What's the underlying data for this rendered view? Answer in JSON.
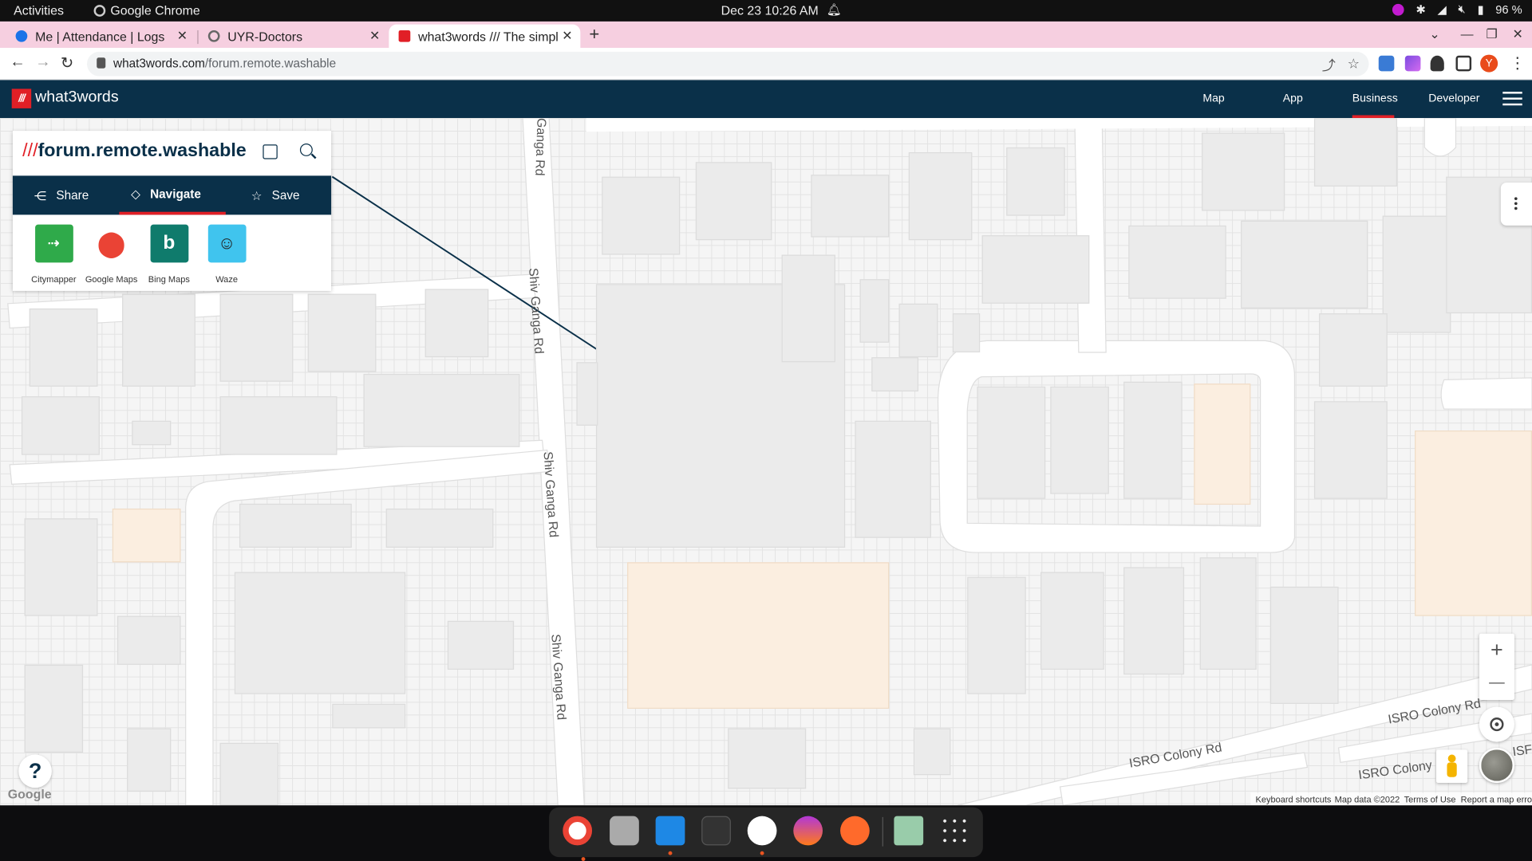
{
  "system_bar": {
    "activities": "Activities",
    "app_name": "Google Chrome",
    "clock": "Dec 23  10:26 AM",
    "battery": "96 %"
  },
  "browser": {
    "tabs": [
      {
        "title": "Me | Attendance | Logs",
        "active": false
      },
      {
        "title": "UYR-Doctors",
        "active": false
      },
      {
        "title": "what3words /// The simpl",
        "active": true
      }
    ],
    "url_host": "what3words.com",
    "url_path": "/forum.remote.washable",
    "profile_initial": "Y"
  },
  "site": {
    "brand": "what3words",
    "logo_text": "///",
    "nav": [
      "Map",
      "App",
      "Business",
      "Developer"
    ],
    "active_nav": "Business"
  },
  "location": {
    "slashes": "///",
    "words": "forum.remote.washable",
    "actions": [
      "Share",
      "Navigate",
      "Save"
    ],
    "selected_action": "Navigate",
    "nav_apps": [
      {
        "name": "Citymapper",
        "color": "#2faa4a",
        "icon": "citymapper-icon"
      },
      {
        "name": "Google Maps",
        "color": "#ffffff",
        "icon": "google-maps-pin-icon"
      },
      {
        "name": "Bing Maps",
        "color": "#0f7b6c",
        "icon": "bing-icon"
      },
      {
        "name": "Waze",
        "color": "#40c4ee",
        "icon": "waze-icon"
      }
    ]
  },
  "map": {
    "road_labels": [
      "Ganga Rd",
      "Shiv Ganga Rd",
      "Shiv Ganga Rd",
      "Shiv Ganga Rd",
      "ISRO Colony Rd",
      "ISRO Colony Rd",
      "ISRO Colony",
      "ISF"
    ],
    "zoom_in": "+",
    "zoom_out": "—",
    "help": "?",
    "google": "Google",
    "attribution": [
      "Keyboard shortcuts",
      "Map data ©2022",
      "Terms of Use",
      "Report a map error"
    ]
  },
  "colors": {
    "brand_navy": "#0a3049",
    "brand_red": "#e11f26",
    "tab_strip": "#f6cfe0"
  }
}
